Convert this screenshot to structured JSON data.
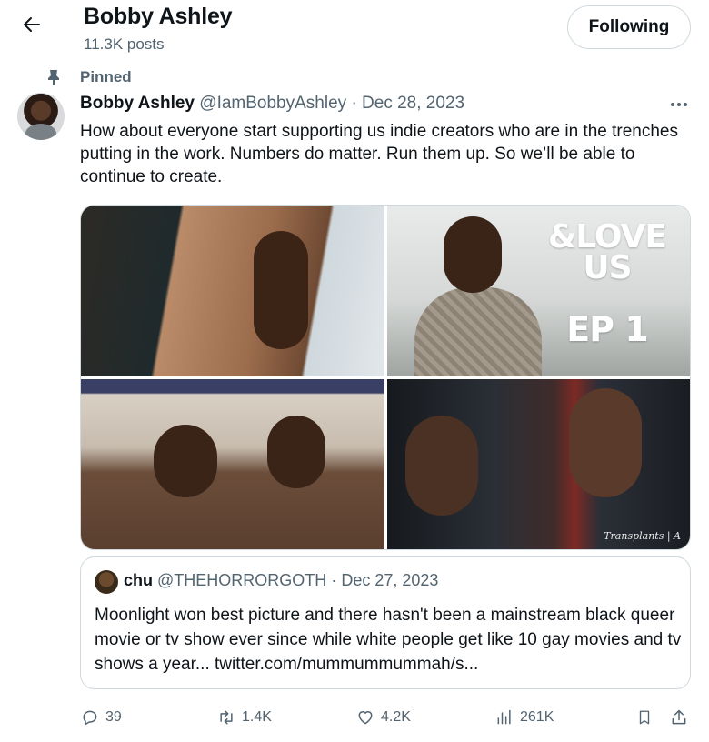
{
  "header": {
    "back_icon": "arrow-left-icon",
    "profile_name": "Bobby Ashley",
    "post_count": "11.3K posts",
    "follow_button_label": "Following"
  },
  "pinned": {
    "icon": "pin-icon",
    "label": "Pinned"
  },
  "tweet": {
    "author_name": "Bobby Ashley",
    "handle": "@IamBobbyAshley",
    "separator": "·",
    "date": "Dec 28, 2023",
    "more_icon": "more-dots-icon",
    "text": "How about everyone start supporting us indie creators who are in the trenches putting in the work. Numbers do matter. Run them up. So we’ll be able to continue to create.",
    "media": {
      "title_card_line1": "&LOVE",
      "title_card_line2": "US",
      "title_card_episode": "EP 1",
      "watermark": "Transplants | A"
    }
  },
  "quote": {
    "author_name": "chu",
    "handle": "@THEHORRORGOTH",
    "separator": "·",
    "date": "Dec 27, 2023",
    "text": "Moonlight won best picture and there hasn't been a mainstream black queer movie or tv show ever since while white people get like 10 gay movies and tv shows a year... twitter.com/mummummummah/s..."
  },
  "actions": {
    "replies": "39",
    "reposts": "1.4K",
    "likes": "4.2K",
    "views": "261K",
    "reply_icon": "reply-icon",
    "repost_icon": "repost-icon",
    "like_icon": "heart-icon",
    "views_icon": "views-chart-icon",
    "bookmark_icon": "bookmark-icon",
    "share_icon": "share-icon"
  },
  "colors": {
    "text_primary": "#0f1419",
    "text_secondary": "#536471",
    "border": "#cfd9de",
    "background": "#ffffff"
  }
}
